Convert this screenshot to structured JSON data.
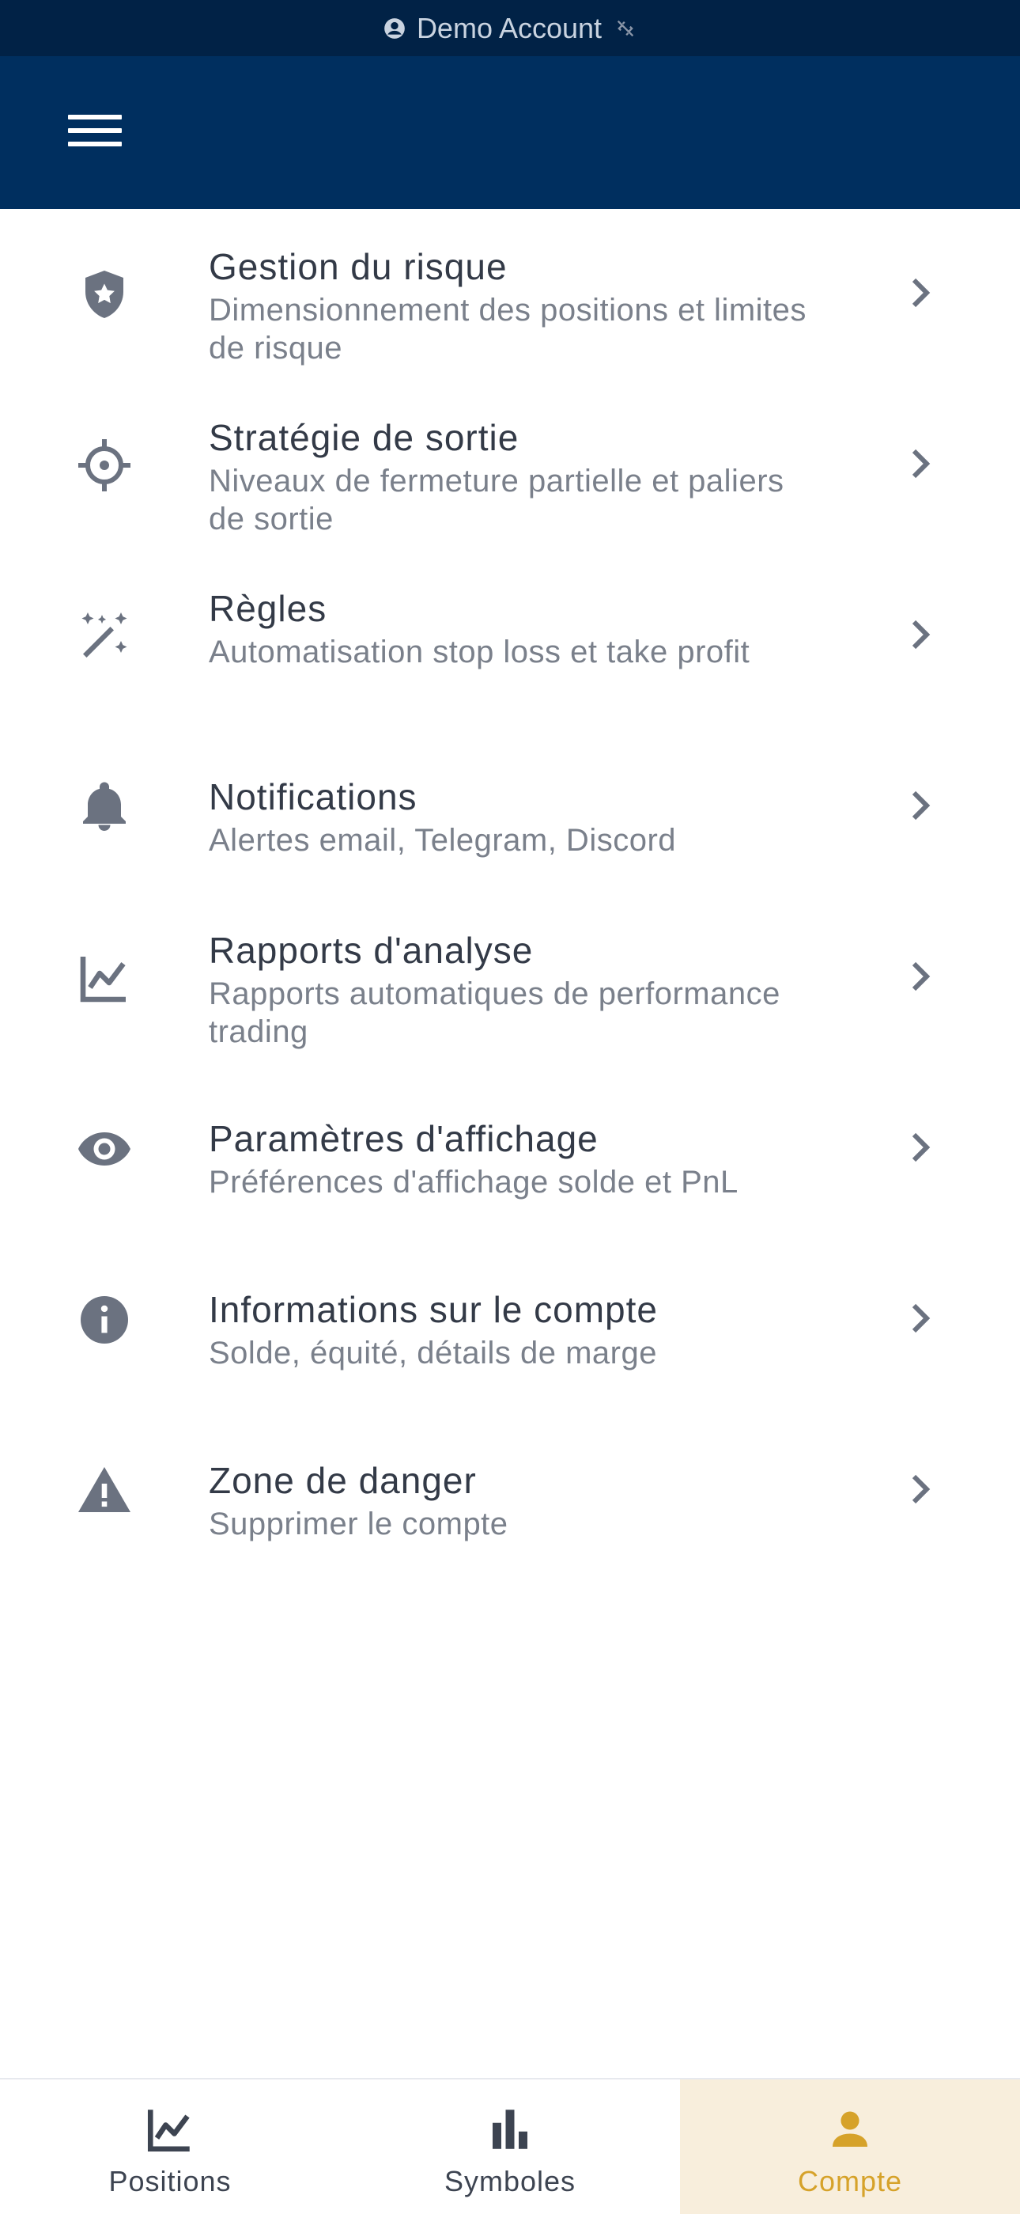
{
  "status_bar": {
    "account_label": "Demo Account",
    "account_icon": "account-circle-icon",
    "connection_icon": "link-off-icon"
  },
  "app_bar": {
    "menu_icon": "hamburger-menu-icon"
  },
  "settings": [
    {
      "title": "Gestion du risque",
      "subtitle": "Dimensionnement des positions et limites de risque",
      "icon": "shield-star-icon"
    },
    {
      "title": "Stratégie de sortie",
      "subtitle": "Niveaux de fermeture partielle et paliers de sortie",
      "icon": "crosshair-icon"
    },
    {
      "title": "Règles",
      "subtitle": "Automatisation stop loss et take profit",
      "icon": "magic-wand-icon"
    },
    {
      "title": "Notifications",
      "subtitle": "Alertes email, Telegram, Discord",
      "icon": "bell-icon"
    },
    {
      "title": "Rapports d'analyse",
      "subtitle": "Rapports automatiques de performance trading",
      "icon": "line-chart-icon"
    },
    {
      "title": "Paramètres d'affichage",
      "subtitle": "Préférences d'affichage solde et PnL",
      "icon": "eye-icon"
    },
    {
      "title": "Informations sur le compte",
      "subtitle": "Solde, équité, détails de marge",
      "icon": "info-icon"
    },
    {
      "title": "Zone de danger",
      "subtitle": "Supprimer le compte",
      "icon": "warning-icon"
    }
  ],
  "bottom_nav": [
    {
      "label": "Positions",
      "icon": "line-chart-icon",
      "active": false
    },
    {
      "label": "Symboles",
      "icon": "bar-chart-icon",
      "active": false
    },
    {
      "label": "Compte",
      "icon": "person-icon",
      "active": true
    }
  ],
  "colors": {
    "status_bar": "#012246",
    "app_bar": "#002f5f",
    "active_accent": "#d6a22a",
    "active_bg": "#f8eedc",
    "icon_gray": "#6b7280"
  }
}
